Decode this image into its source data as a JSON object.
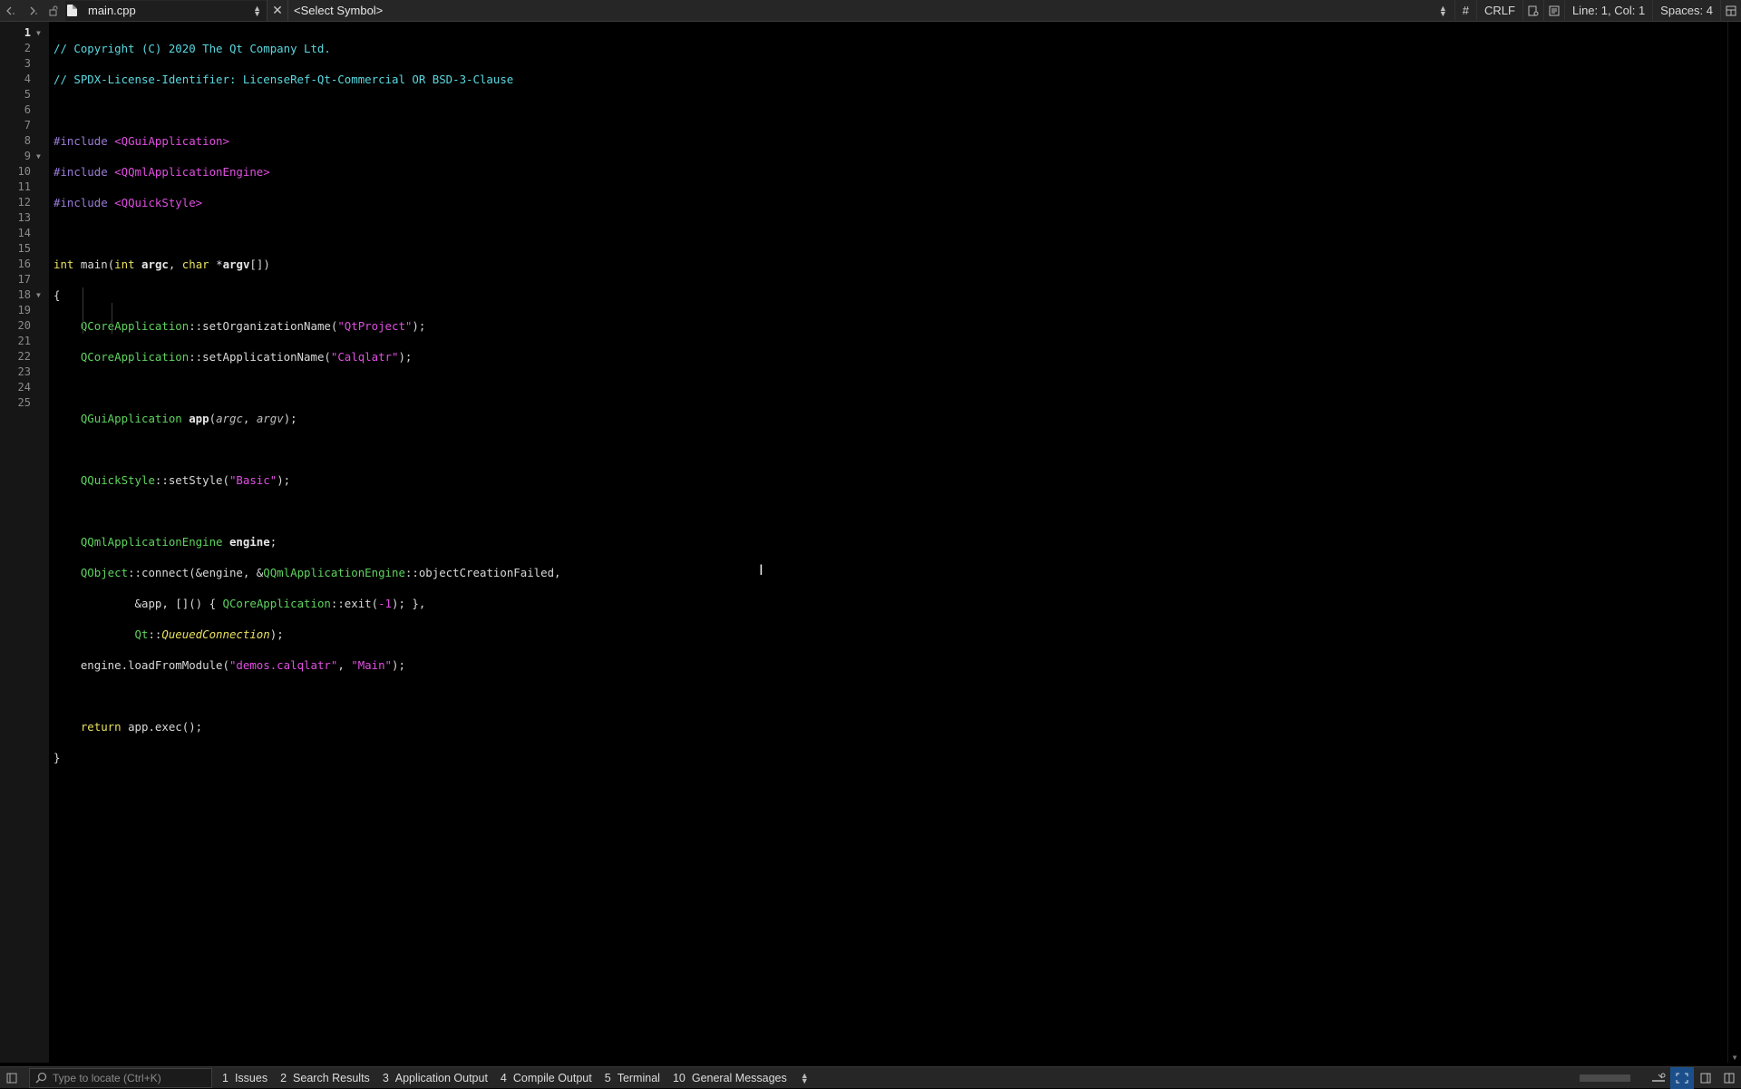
{
  "toolbar": {
    "back_icon": "chevron-left-icon",
    "forward_icon": "chevron-right-icon",
    "lock_icon": "lock-icon",
    "file_name": "main.cpp",
    "close_glyph": "✕",
    "symbol_placeholder": "<Select Symbol>",
    "hash": "#",
    "line_ending": "CRLF",
    "cursor_position": "Line: 1, Col: 1",
    "indentation": "Spaces: 4"
  },
  "editor": {
    "current_line": 1,
    "line_count": 25,
    "fold_markers_at_lines": [
      1,
      9,
      18
    ]
  },
  "colors": {
    "comment": "#5ad8e0",
    "preprocessor": "#9a7cd8",
    "string": "#e04fe0",
    "keyword": "#e8e060",
    "type": "#5fd35f",
    "background": "#000000",
    "active_accent": "#1b4f8c"
  },
  "bottom_bar": {
    "locator_placeholder": "Type to locate (Ctrl+K)",
    "tabs": [
      {
        "num": "1",
        "label": "Issues"
      },
      {
        "num": "2",
        "label": "Search Results"
      },
      {
        "num": "3",
        "label": "Application Output"
      },
      {
        "num": "4",
        "label": "Compile Output"
      },
      {
        "num": "5",
        "label": "Terminal"
      },
      {
        "num": "10",
        "label": "General Messages"
      }
    ]
  }
}
